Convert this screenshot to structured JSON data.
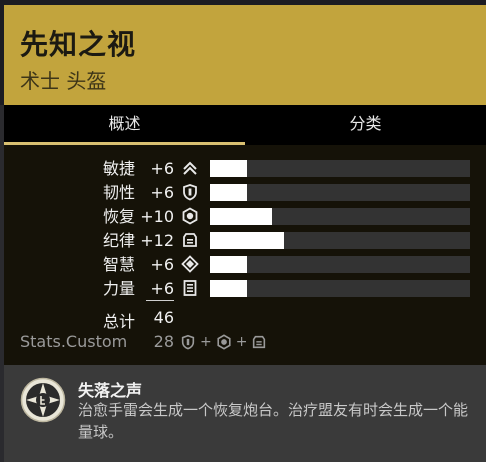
{
  "item": {
    "name": "先知之视",
    "type": "术士 头盔"
  },
  "tabs": [
    {
      "label": "概述",
      "active": true
    },
    {
      "label": "分类",
      "active": false
    }
  ],
  "stats": [
    {
      "name": "敏捷",
      "value": "+6",
      "icon": "mobility-icon",
      "bar": 6
    },
    {
      "name": "韧性",
      "value": "+6",
      "icon": "resilience-icon",
      "bar": 6
    },
    {
      "name": "恢复",
      "value": "+10",
      "icon": "recovery-icon",
      "bar": 10
    },
    {
      "name": "纪律",
      "value": "+12",
      "icon": "discipline-icon",
      "bar": 12
    },
    {
      "name": "智慧",
      "value": "+6",
      "icon": "intellect-icon",
      "bar": 6
    },
    {
      "name": "力量",
      "value": "+6",
      "icon": "strength-icon",
      "bar": 6
    }
  ],
  "bar_max": 42,
  "total": {
    "label": "总计",
    "value": "46"
  },
  "custom": {
    "label": "Stats.Custom",
    "value": "28",
    "plus": "+",
    "icons": [
      "resilience-icon",
      "recovery-icon",
      "discipline-icon"
    ]
  },
  "perk": {
    "name": "失落之声",
    "description": "治愈手雷会生成一个恢复炮台。治疗盟友有时会生成一个能量球。",
    "icon": "perk-compass-icon"
  },
  "colors": {
    "header": "#c2a43d",
    "tab_underline": "#d9c071",
    "bar_fill": "#ffffff",
    "bar_track": "#333333"
  }
}
